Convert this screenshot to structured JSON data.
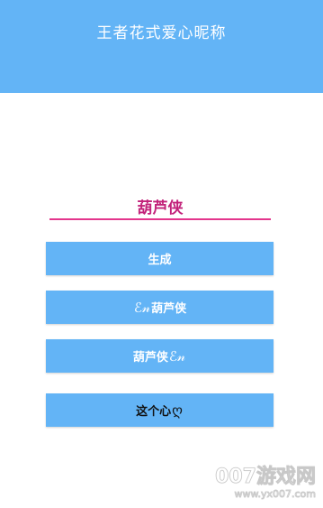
{
  "header": {
    "title": "王者花式爱心昵称"
  },
  "input": {
    "value": "葫芦侠"
  },
  "buttons": {
    "generate_label": "生成",
    "variant_left_decoration": "ℰ𝓃",
    "variant_left_text": "葫芦侠",
    "variant_right_text": "葫芦侠",
    "variant_right_decoration": "ℰ𝓃",
    "heart_text": "这个心",
    "heart_symbol": "ღ"
  },
  "watermark": {
    "brand": "007游戏网",
    "url": "www.yx007.com"
  },
  "colors": {
    "header_bg": "#63b4f6",
    "button_bg": "#63b4f6",
    "input_underline": "#e3358c",
    "input_text": "#c2227a"
  }
}
